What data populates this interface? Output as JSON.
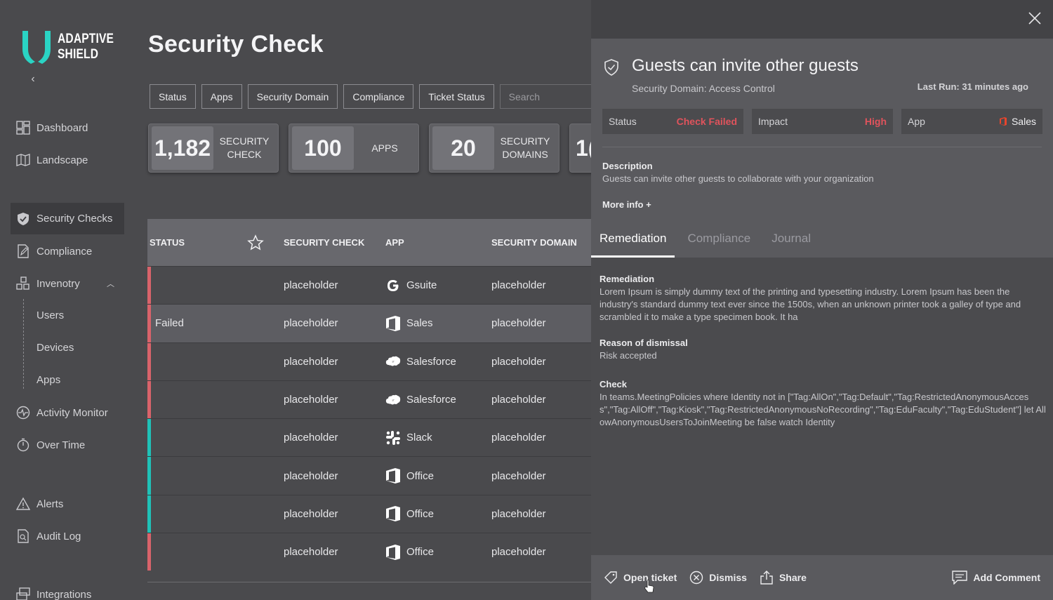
{
  "brand": {
    "line1": "ADAPTIVE",
    "line2": "SHIELD",
    "accent": "#2ad4c4"
  },
  "sidebar": {
    "collapse_glyph": "‹",
    "items": [
      {
        "label": "Dashboard",
        "icon": "dashboard-icon"
      },
      {
        "label": "Landscape",
        "icon": "map-icon"
      },
      {
        "label": "Security Checks",
        "icon": "shield-check-icon",
        "active": true
      },
      {
        "label": "Compliance",
        "icon": "document-edit-icon"
      },
      {
        "label": "Invenotry",
        "icon": "blocks-icon",
        "expanded": true
      },
      {
        "label": "Activity Monitor",
        "icon": "pulse-icon"
      },
      {
        "label": "Over Time",
        "icon": "stopwatch-icon"
      },
      {
        "label": "Alerts",
        "icon": "warning-icon"
      },
      {
        "label": "Audit Log",
        "icon": "audit-icon"
      },
      {
        "label": "Integrations",
        "icon": "integrations-icon"
      }
    ],
    "inventory_sub": [
      "Users",
      "Devices",
      "Apps"
    ]
  },
  "page": {
    "title": "Security Check"
  },
  "filters": {
    "buttons": [
      "Status",
      "Apps",
      "Security Domain",
      "Compliance",
      "Ticket Status"
    ],
    "search_placeholder": "Search"
  },
  "stats": [
    {
      "value": "1,182",
      "label": "SECURITY CHECK"
    },
    {
      "value": "100",
      "label": "APPS"
    },
    {
      "value": "20",
      "label": "SECURITY DOMAINS"
    },
    {
      "value": "1(",
      "label": ""
    }
  ],
  "table": {
    "headers": {
      "status": "STATUS",
      "check": "SECURITY CHECK",
      "app": "APP",
      "domain": "SECURITY DOMAIN"
    },
    "rows": [
      {
        "status": "",
        "check": "placeholder",
        "app": "Gsuite",
        "app_icon": "google-icon",
        "domain": "placeholder",
        "bar": "#d9636b"
      },
      {
        "status": "Failed",
        "check": "placeholder",
        "app": "Sales",
        "app_icon": "office-icon",
        "domain": "placeholder",
        "bar": "#d9636b",
        "selected": true
      },
      {
        "status": "",
        "check": "placeholder",
        "app": "Salesforce",
        "app_icon": "salesforce-icon",
        "domain": "placeholder",
        "bar": "#d9636b"
      },
      {
        "status": "",
        "check": "placeholder",
        "app": "Salesforce",
        "app_icon": "salesforce-icon",
        "domain": "placeholder",
        "bar": "#d9636b"
      },
      {
        "status": "",
        "check": "placeholder",
        "app": "Slack",
        "app_icon": "slack-icon",
        "domain": "placeholder",
        "bar": "#1fc2b8"
      },
      {
        "status": "",
        "check": "placeholder",
        "app": "Office",
        "app_icon": "office-icon",
        "domain": "placeholder",
        "bar": "#1fc2b8"
      },
      {
        "status": "",
        "check": "placeholder",
        "app": "Office",
        "app_icon": "office-icon",
        "domain": "placeholder",
        "bar": "#1fc2b8"
      },
      {
        "status": "",
        "check": "placeholder",
        "app": "Office",
        "app_icon": "office-icon",
        "domain": "placeholder",
        "bar": "#d9636b"
      }
    ]
  },
  "drawer": {
    "title": "Guests can invite other guests",
    "domain": "Security Domain: Access Control",
    "last_run": "Last Run: 31 minutes ago",
    "status_label": "Status",
    "status_value": "Check Failed",
    "impact_label": "Impact",
    "impact_value": "High",
    "app_label": "App",
    "app_value": "Sales",
    "description_title": "Description",
    "description_text": "Guests can invite other guests to collaborate with your organization",
    "more_info": "More info +",
    "tabs": [
      "Remediation",
      "Compliance",
      "Journal"
    ],
    "remediation_title": "Remediation",
    "remediation_text": "Lorem Ipsum is simply dummy text of the printing and typesetting industry. Lorem Ipsum has been the industry's standard dummy text ever since the 1500s, when an unknown printer took a galley of type and scrambled it to make a type specimen book. It ha",
    "dismissal_title": "Reason of dismissal",
    "dismissal_text": "Risk accepted",
    "check_title": "Check",
    "check_text": "In teams.MeetingPolicies where Identity not in [\"Tag:AllOn\",\"Tag:Default\",\"Tag:RestrictedAnonymousAccess\",\"Tag:AllOff\",\"Tag:Kiosk\",\"Tag:RestrictedAnonymousNoRecording\",\"Tag:EduFaculty\",\"Tag:EduStudent\"] let AllowAnonymousUsersToJoinMeeting be false watch Identity",
    "footer": {
      "open_ticket": "Open ticket",
      "dismiss": "Dismiss",
      "share": "Share",
      "add_comment": "Add Comment"
    }
  },
  "colors": {
    "failed": "#e0535c",
    "passed_bar": "#1fc2b8",
    "failed_bar": "#d9636b"
  }
}
